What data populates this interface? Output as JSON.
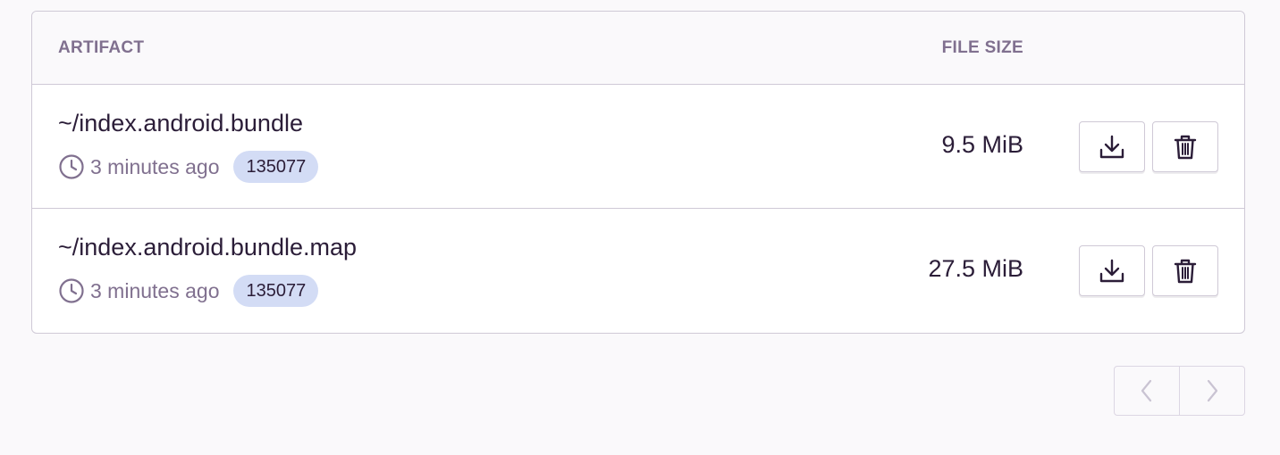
{
  "table": {
    "columns": {
      "artifact": "ARTIFACT",
      "file_size": "FILE SIZE"
    },
    "rows": [
      {
        "name": "~/index.android.bundle",
        "time": "3 minutes ago",
        "badge": "135077",
        "size": "9.5 MiB",
        "actions": [
          "download-icon",
          "trash-icon"
        ]
      },
      {
        "name": "~/index.android.bundle.map",
        "time": "3 minutes ago",
        "badge": "135077",
        "size": "27.5 MiB",
        "actions": [
          "download-icon",
          "trash-icon"
        ]
      }
    ]
  },
  "pagination": {
    "previous_icon": "chevron-left-icon",
    "next_icon": "chevron-right-icon"
  },
  "colors": {
    "text": "#2b1d38",
    "muted": "#80708f",
    "border": "#cfc9d6",
    "badge_bg": "#d3dcf5"
  }
}
